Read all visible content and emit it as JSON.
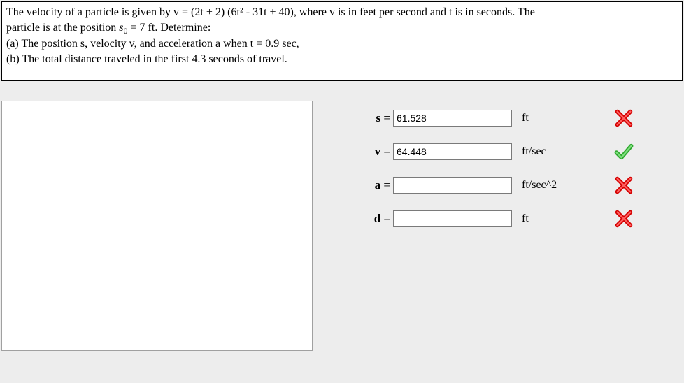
{
  "problem": {
    "line1": "The velocity of a particle is given by v = (2t + 2) (6t² - 31t +  40), where v is in feet per second and t is in seconds.  The",
    "line2_prefix": "particle is at the position ",
    "line2_s0": "s",
    "line2_sub0": "0",
    "line2_rest": " = 7 ft.  Determine:",
    "line3": "(a) The position s, velocity v, and acceleration a when t = 0.9 sec,",
    "line4": "(b) The total distance traveled in the first 4.3 seconds of travel."
  },
  "answers": [
    {
      "label": "s",
      "value": "61.528",
      "unit": "ft",
      "status": "wrong"
    },
    {
      "label": "v",
      "value": "64.448",
      "unit": "ft/sec",
      "status": "correct"
    },
    {
      "label": "a",
      "value": "",
      "unit": "ft/sec^2",
      "status": "wrong"
    },
    {
      "label": "d",
      "value": "",
      "unit": "ft",
      "status": "wrong"
    }
  ],
  "icons": {
    "wrong_color": "#d40000",
    "correct_color": "#2fa82f"
  }
}
